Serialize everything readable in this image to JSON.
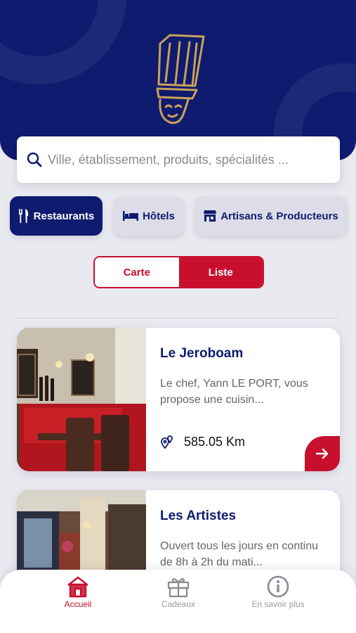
{
  "header": {
    "logo": "chef-hat-logo"
  },
  "search": {
    "placeholder": "Ville, établissement, produits, spécialités ..."
  },
  "categories": [
    {
      "label": "Restaurants",
      "icon": "fork-knife-icon",
      "active": true
    },
    {
      "label": "Hôtels",
      "icon": "bed-icon",
      "active": false
    },
    {
      "label": "Artisans & Producteurs",
      "icon": "shop-icon",
      "active": false
    }
  ],
  "view_toggle": {
    "carte": "Carte",
    "liste": "Liste",
    "selected": "Liste"
  },
  "cards": [
    {
      "title": "Le Jeroboam",
      "description": "Le chef, Yann LE PORT, vous propose une cuisin...",
      "distance": "585.05 Km"
    },
    {
      "title": "Les Artistes",
      "description": "Ouvert tous les jours en continu de 8h à 2h du mati..."
    }
  ],
  "tabbar": [
    {
      "label": "Accueil",
      "icon": "home-icon",
      "active": true
    },
    {
      "label": "Cadeaux",
      "icon": "gift-icon",
      "active": false
    },
    {
      "label": "En savoir plus",
      "icon": "info-icon",
      "active": false
    }
  ],
  "colors": {
    "primary": "#0f1b6e",
    "accent": "#c8102e",
    "background": "#e9e9f0"
  }
}
